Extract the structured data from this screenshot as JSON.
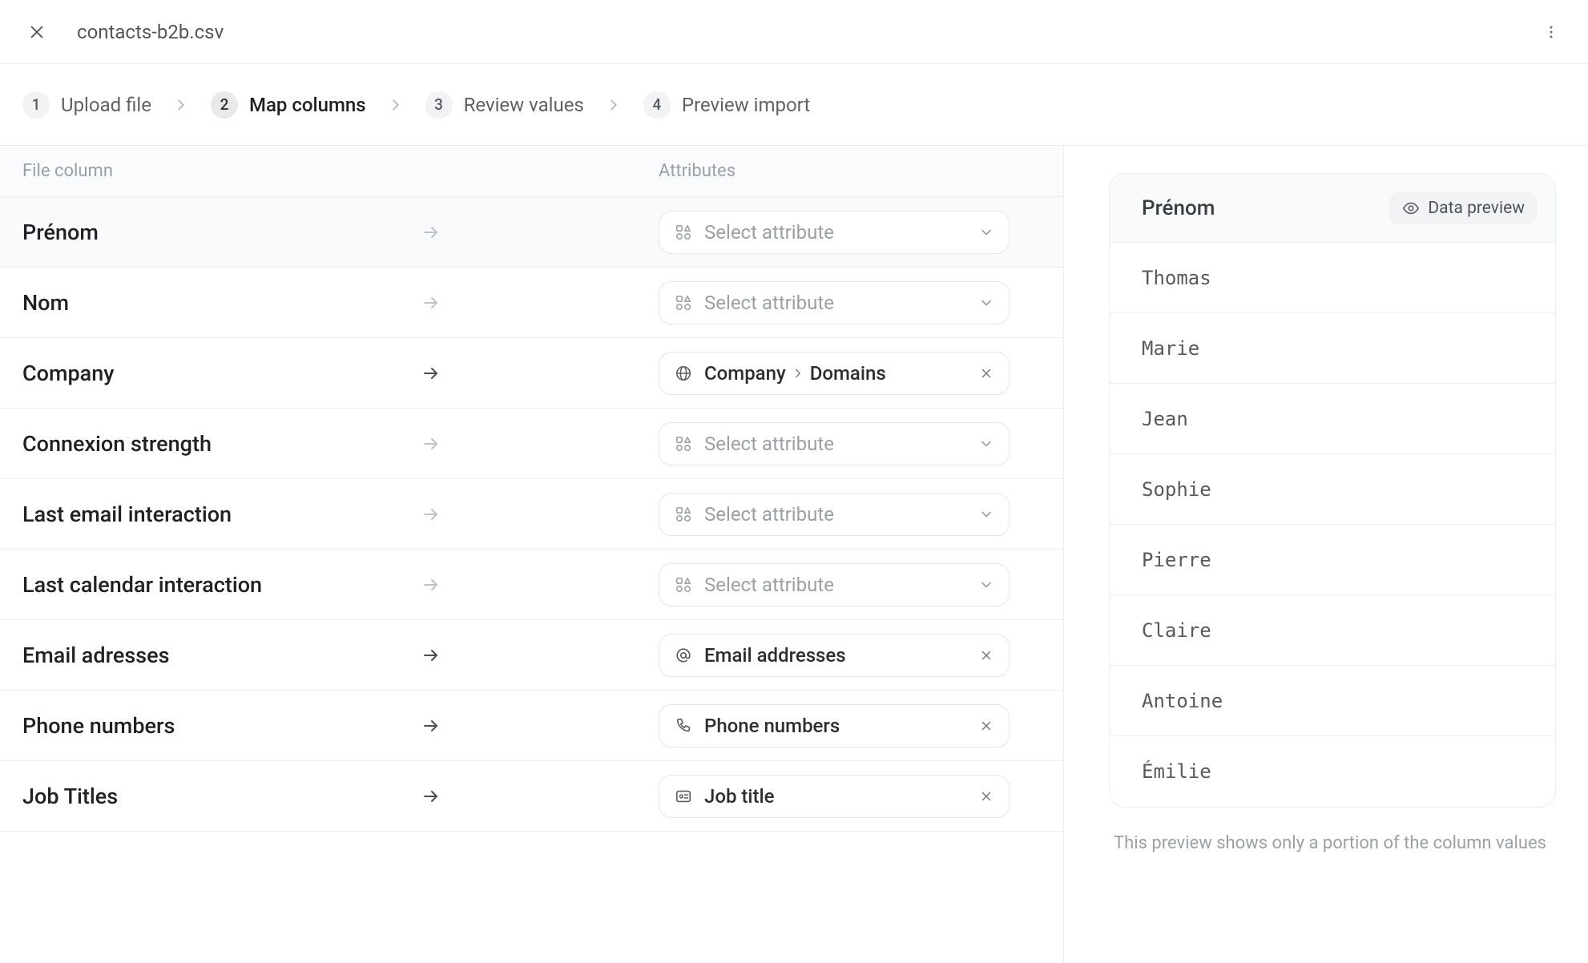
{
  "file": {
    "name": "contacts-b2b.csv"
  },
  "steps": [
    {
      "num": "1",
      "label": "Upload file"
    },
    {
      "num": "2",
      "label": "Map columns"
    },
    {
      "num": "3",
      "label": "Review values"
    },
    {
      "num": "4",
      "label": "Preview import"
    }
  ],
  "active_step_index": 1,
  "headers": {
    "file_column": "File column",
    "attributes": "Attributes"
  },
  "placeholder_text": "Select attribute",
  "rows": [
    {
      "file_col": "Prénom",
      "mapped": false,
      "selected": true
    },
    {
      "file_col": "Nom",
      "mapped": false
    },
    {
      "file_col": "Company",
      "mapped": true,
      "icon": "globe",
      "attr_primary": "Company",
      "attr_secondary": "Domains"
    },
    {
      "file_col": "Connexion strength",
      "mapped": false
    },
    {
      "file_col": "Last email interaction",
      "mapped": false
    },
    {
      "file_col": "Last calendar interaction",
      "mapped": false
    },
    {
      "file_col": "Email adresses",
      "mapped": true,
      "icon": "at",
      "attr_primary": "Email addresses"
    },
    {
      "file_col": "Phone numbers",
      "mapped": true,
      "icon": "phone",
      "attr_primary": "Phone numbers"
    },
    {
      "file_col": "Job Titles",
      "mapped": true,
      "icon": "badge",
      "attr_primary": "Job title"
    }
  ],
  "preview": {
    "column": "Prénom",
    "badge": "Data preview",
    "values": [
      "Thomas",
      "Marie",
      "Jean",
      "Sophie",
      "Pierre",
      "Claire",
      "Antoine",
      "Émilie"
    ],
    "note": "This preview shows only a portion of the column values"
  }
}
